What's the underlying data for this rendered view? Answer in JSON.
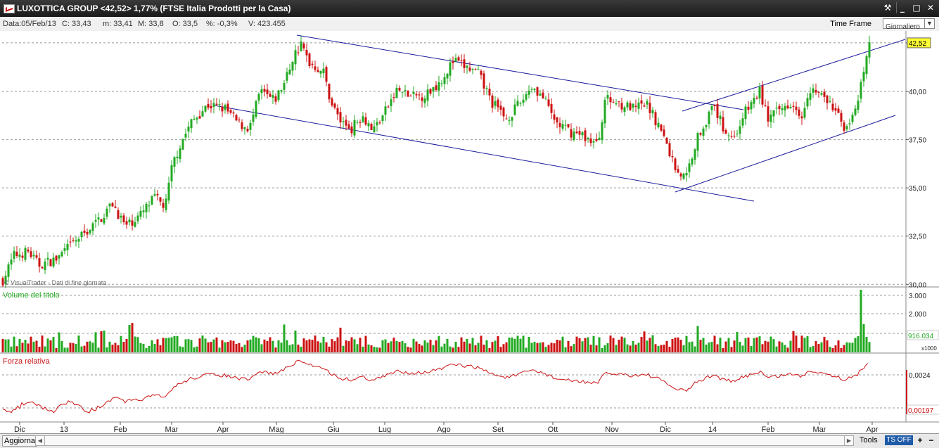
{
  "window": {
    "title": "LUXOTTICA GROUP <42,52> 1,77%  (FTSE Italia Prodotti per la Casa)",
    "buttons": [
      "⚒",
      "_",
      "□",
      "✕"
    ]
  },
  "infobar": {
    "date": "Data:05/Feb/13",
    "close": "C: 33,43",
    "min": "m: 33,41",
    "max": "M: 33,8",
    "open": "O: 33,5",
    "pct": "%: -0,3%",
    "volume": "V: 423.455",
    "time_frame_label": "Time Frame",
    "time_frame_value": "Giornaliero"
  },
  "colors": {
    "up": "#22aa22",
    "down": "#cc1111",
    "trendline": "#1a1a9c",
    "rsi_line": "#cc1111",
    "grid": "#999999",
    "last_price_bg": "#ffff33"
  },
  "chart_data": {
    "type": "candlestick",
    "price_axis": {
      "ticks": [
        "30,00",
        "32,50",
        "35,00",
        "37,50",
        "40,00",
        "42,52"
      ],
      "range": [
        29.9,
        43.1
      ]
    },
    "last_price": "42,52",
    "watermark": "© VisualTrader - Dati di fine giornata",
    "x_labels": [
      "Dic",
      "13",
      "Feb",
      "Mar",
      "Apr",
      "Mag",
      "Giu",
      "Lug",
      "Ago",
      "Set",
      "Ott",
      "Nov",
      "Dic",
      "14",
      "Feb",
      "Mar",
      "Apr"
    ],
    "price_anchors": [
      [
        0,
        29.9
      ],
      [
        20,
        31.5
      ],
      [
        40,
        31.7
      ],
      [
        55,
        31.0
      ],
      [
        80,
        31.3
      ],
      [
        100,
        32.0
      ],
      [
        125,
        32.8
      ],
      [
        145,
        33.5
      ],
      [
        160,
        34.2
      ],
      [
        178,
        33.0
      ],
      [
        200,
        33.6
      ],
      [
        220,
        34.5
      ],
      [
        235,
        34.0
      ],
      [
        245,
        36.2
      ],
      [
        258,
        37.4
      ],
      [
        272,
        38.4
      ],
      [
        295,
        39.3
      ],
      [
        320,
        39.1
      ],
      [
        340,
        38.3
      ],
      [
        355,
        38.1
      ],
      [
        370,
        40.0
      ],
      [
        390,
        39.5
      ],
      [
        405,
        40.5
      ],
      [
        418,
        41.9
      ],
      [
        428,
        42.4
      ],
      [
        440,
        41.5
      ],
      [
        460,
        41.0
      ],
      [
        470,
        39.5
      ],
      [
        485,
        38.4
      ],
      [
        500,
        38.1
      ],
      [
        515,
        38.8
      ],
      [
        530,
        38.0
      ],
      [
        545,
        38.8
      ],
      [
        565,
        40.1
      ],
      [
        585,
        39.7
      ],
      [
        605,
        39.8
      ],
      [
        625,
        40.5
      ],
      [
        645,
        41.6
      ],
      [
        660,
        41.3
      ],
      [
        680,
        40.9
      ],
      [
        700,
        39.4
      ],
      [
        720,
        38.6
      ],
      [
        740,
        39.4
      ],
      [
        755,
        40.3
      ],
      [
        770,
        39.8
      ],
      [
        790,
        38.4
      ],
      [
        810,
        37.9
      ],
      [
        830,
        37.7
      ],
      [
        850,
        37.2
      ],
      [
        860,
        39.6
      ],
      [
        880,
        39.4
      ],
      [
        900,
        39.1
      ],
      [
        920,
        39.3
      ],
      [
        940,
        38.0
      ],
      [
        950,
        37.0
      ],
      [
        962,
        35.9
      ],
      [
        975,
        35.5
      ],
      [
        990,
        37.5
      ],
      [
        1005,
        38.6
      ],
      [
        1015,
        39.2
      ],
      [
        1030,
        38.0
      ],
      [
        1045,
        37.6
      ],
      [
        1055,
        38.7
      ],
      [
        1065,
        39.2
      ],
      [
        1080,
        40.0
      ],
      [
        1092,
        38.6
      ],
      [
        1108,
        39.0
      ],
      [
        1125,
        39.5
      ],
      [
        1140,
        38.8
      ],
      [
        1150,
        40.2
      ],
      [
        1165,
        39.9
      ],
      [
        1185,
        39.1
      ],
      [
        1200,
        38.2
      ],
      [
        1215,
        38.7
      ],
      [
        1225,
        40.4
      ],
      [
        1236,
        42.5
      ]
    ],
    "volume_panel": {
      "label": "Volume del titolo",
      "ticks": [
        "3.000",
        "2.000"
      ],
      "last_value": "916.034",
      "unit": "x1000"
    },
    "rsi_panel": {
      "label": "Forza relativa",
      "ticks": [
        "0,0024"
      ],
      "last_value": "0,00197"
    },
    "trendlines": [
      {
        "name": "upper descending",
        "from": [
          "Mag",
          42.7
        ],
        "to": [
          "Dic",
          39.5
        ]
      },
      {
        "name": "lower descending",
        "from": [
          "Apr",
          39.5
        ],
        "to": [
          "Gen",
          34.6
        ]
      },
      {
        "name": "upper ascending",
        "from": [
          "Dic",
          39.4
        ],
        "to": [
          "Apr",
          43.0
        ]
      },
      {
        "name": "lower ascending",
        "from": [
          "Dic",
          35.0
        ],
        "to": [
          "Apr",
          39.0
        ]
      }
    ]
  },
  "bottombar": {
    "refresh": "Aggiorna",
    "tools": "Tools",
    "ts": "TS OFF",
    "plus": "+",
    "minus": "−"
  }
}
